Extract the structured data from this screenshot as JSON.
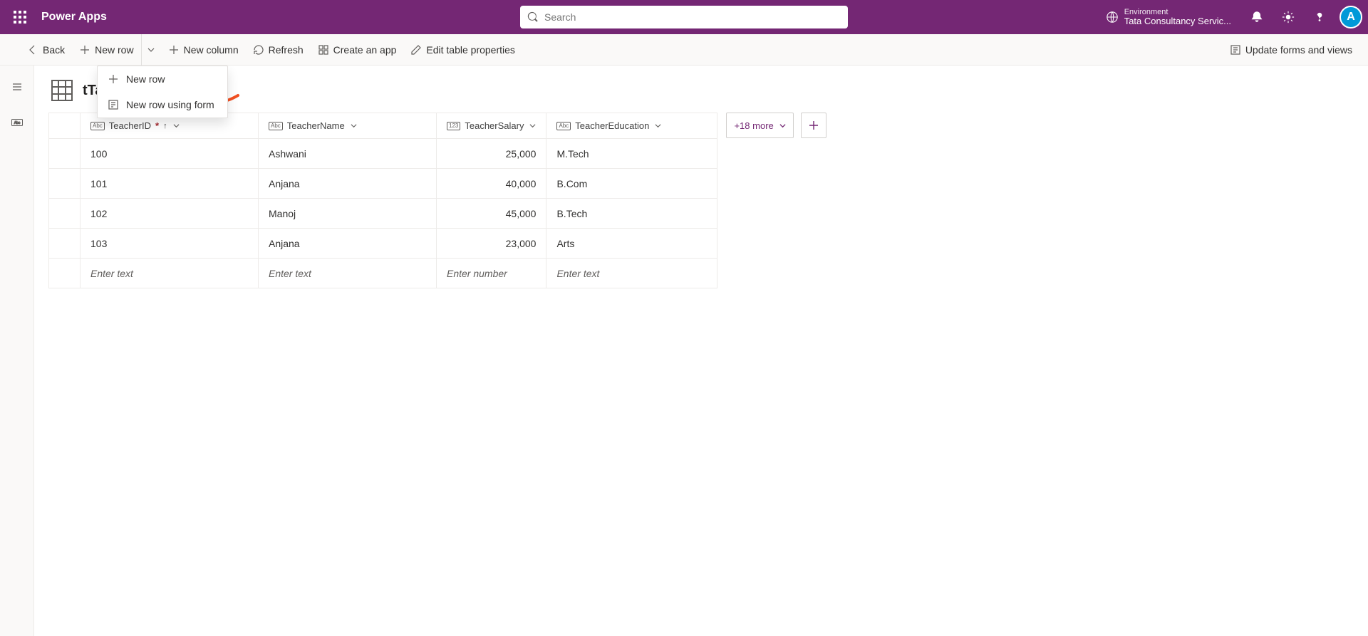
{
  "header": {
    "brand": "Power Apps",
    "search_placeholder": "Search",
    "env_label": "Environment",
    "env_name": "Tata Consultancy Servic...",
    "avatar_letter": "A"
  },
  "commands": {
    "back": "Back",
    "new_row": "New row",
    "new_column": "New column",
    "refresh": "Refresh",
    "create_app": "Create an app",
    "edit_props": "Edit table properties",
    "update_forms": "Update forms and views"
  },
  "dropdown": {
    "new_row": "New row",
    "new_row_form": "New row using form"
  },
  "table": {
    "title": "tTables",
    "more_columns": "+18 more",
    "columns": {
      "id": "TeacherID",
      "name": "TeacherName",
      "salary": "TeacherSalary",
      "education": "TeacherEducation"
    },
    "placeholders": {
      "text": "Enter text",
      "number": "Enter number"
    },
    "rows": [
      {
        "id": "100",
        "name": "Ashwani",
        "salary": "25,000",
        "education": "M.Tech"
      },
      {
        "id": "101",
        "name": "Anjana",
        "salary": "40,000",
        "education": "B.Com"
      },
      {
        "id": "102",
        "name": "Manoj",
        "salary": "45,000",
        "education": "B.Tech"
      },
      {
        "id": "103",
        "name": "Anjana",
        "salary": "23,000",
        "education": "Arts"
      }
    ]
  }
}
